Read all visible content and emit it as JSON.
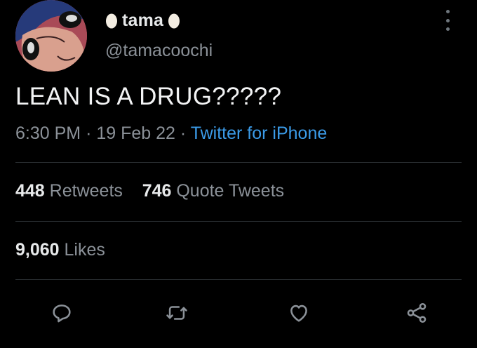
{
  "tweet": {
    "display_name": "tama",
    "handle": "@tamacoochi",
    "text": "LEAN IS A DRUG?????",
    "time": "6:30 PM",
    "date": "19 Feb 22",
    "source": "Twitter for iPhone",
    "separator": "·"
  },
  "stats": {
    "retweets_count": "448",
    "retweets_label": "Retweets",
    "quotes_count": "746",
    "quotes_label": "Quote Tweets",
    "likes_count": "9,060",
    "likes_label": "Likes"
  },
  "icons": {
    "more": "more-vertical-icon",
    "reply": "reply-icon",
    "retweet": "retweet-icon",
    "like": "heart-icon",
    "share": "share-icon",
    "name_decoration": "egg-icon"
  },
  "colors": {
    "background": "#000000",
    "text": "#e7e9ea",
    "secondary": "#8b9198",
    "link": "#3b9be8"
  }
}
